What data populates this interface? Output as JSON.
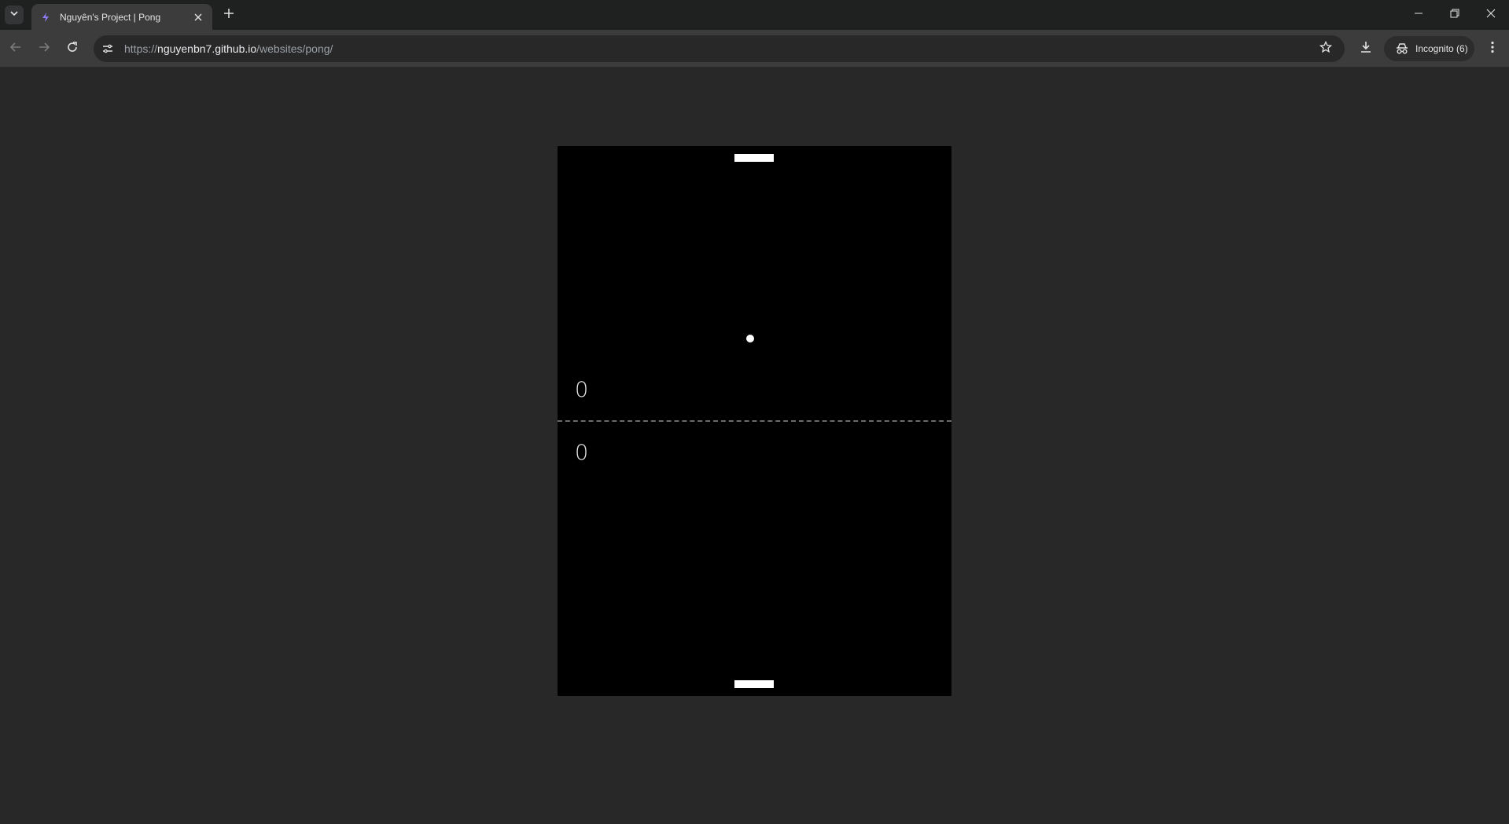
{
  "browser": {
    "tab": {
      "title": "Nguyên's Project | Pong",
      "favicon": "lightning-icon",
      "active": true
    },
    "url": {
      "scheme": "https://",
      "host": "nguyenbn7.github.io",
      "path": "/websites/pong/"
    },
    "incognito_label": "Incognito (6)",
    "icons": {
      "tab_search": "chevron-down-icon",
      "tab_close": "close-icon",
      "new_tab": "plus-icon",
      "back": "arrow-left-icon",
      "forward": "arrow-right-icon",
      "reload": "reload-icon",
      "site_info": "tune-icon",
      "bookmark": "star-icon",
      "download": "download-icon",
      "incognito": "incognito-icon",
      "menu": "kebab-menu-icon",
      "minimize": "minimize-icon",
      "restore": "restore-icon",
      "close_window": "close-icon"
    }
  },
  "game": {
    "score_top": "0",
    "score_bottom": "0",
    "colors": {
      "field": "#000000",
      "paddle": "#ffffff",
      "ball": "#ffffff",
      "midline": "#6a6a6a"
    }
  }
}
